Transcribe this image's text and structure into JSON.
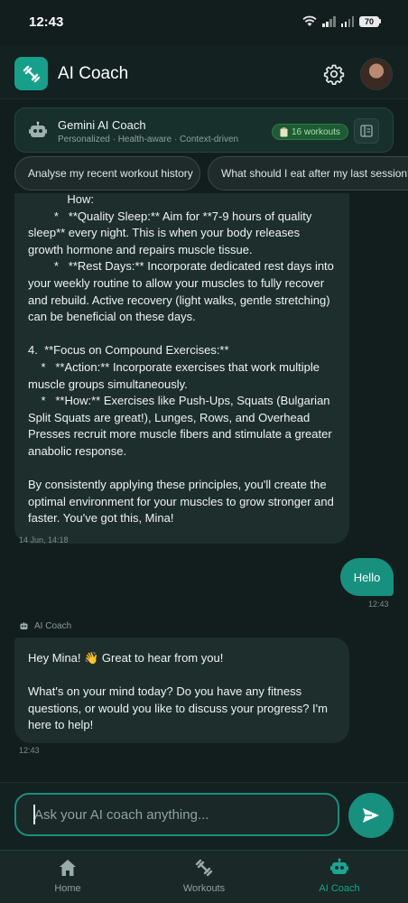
{
  "status_bar": {
    "time": "12:43",
    "battery": "70"
  },
  "app_bar": {
    "title": "AI Coach"
  },
  "coach_card": {
    "name": "Gemini AI Coach",
    "subtitle": "Personalized · Health-aware · Context-driven",
    "workouts_badge": "16 workouts"
  },
  "suggestions": [
    "Analyse my recent workout history",
    "What should I eat after my last session?"
  ],
  "messages": [
    {
      "role": "ai",
      "text": "            How:\n        *   **Quality Sleep:** Aim for **7-9 hours of quality sleep** every night. This is when your body releases growth hormone and repairs muscle tissue.\n        *   **Rest Days:** Incorporate dedicated rest days into your weekly routine to allow your muscles to fully recover and rebuild. Active recovery (light walks, gentle stretching) can be beneficial on these days.\n\n4.  **Focus on Compound Exercises:**\n    *   **Action:** Incorporate exercises that work multiple muscle groups simultaneously.\n    *   **How:** Exercises like Push-Ups, Squats (Bulgarian Split Squats are great!), Lunges, Rows, and Overhead Presses recruit more muscle fibers and stimulate a greater anabolic response.\n\nBy consistently applying these principles, you'll create the optimal environment for your muscles to grow stronger and faster. You've got this, Mina!",
      "timestamp": "14 Jun, 14:18"
    },
    {
      "role": "user",
      "text": "Hello",
      "timestamp": "12:43"
    },
    {
      "role": "ai",
      "sender": "AI Coach",
      "text": "Hey Mina! 👋 Great to hear from you!\n\nWhat's on your mind today? Do you have any fitness questions, or would you like to discuss your progress? I'm here to help!",
      "timestamp": "12:43"
    }
  ],
  "composer": {
    "placeholder": "Ask your AI coach anything..."
  },
  "bottom_nav": [
    {
      "label": "Home",
      "icon": "home-icon",
      "active": false
    },
    {
      "label": "Workouts",
      "icon": "dumbbell-icon",
      "active": false
    },
    {
      "label": "AI Coach",
      "icon": "robot-icon",
      "active": true
    }
  ],
  "colors": {
    "accent": "#17907f",
    "background": "#111e1d",
    "bubble": "#1e2e2c",
    "active_nav": "#15a792"
  }
}
